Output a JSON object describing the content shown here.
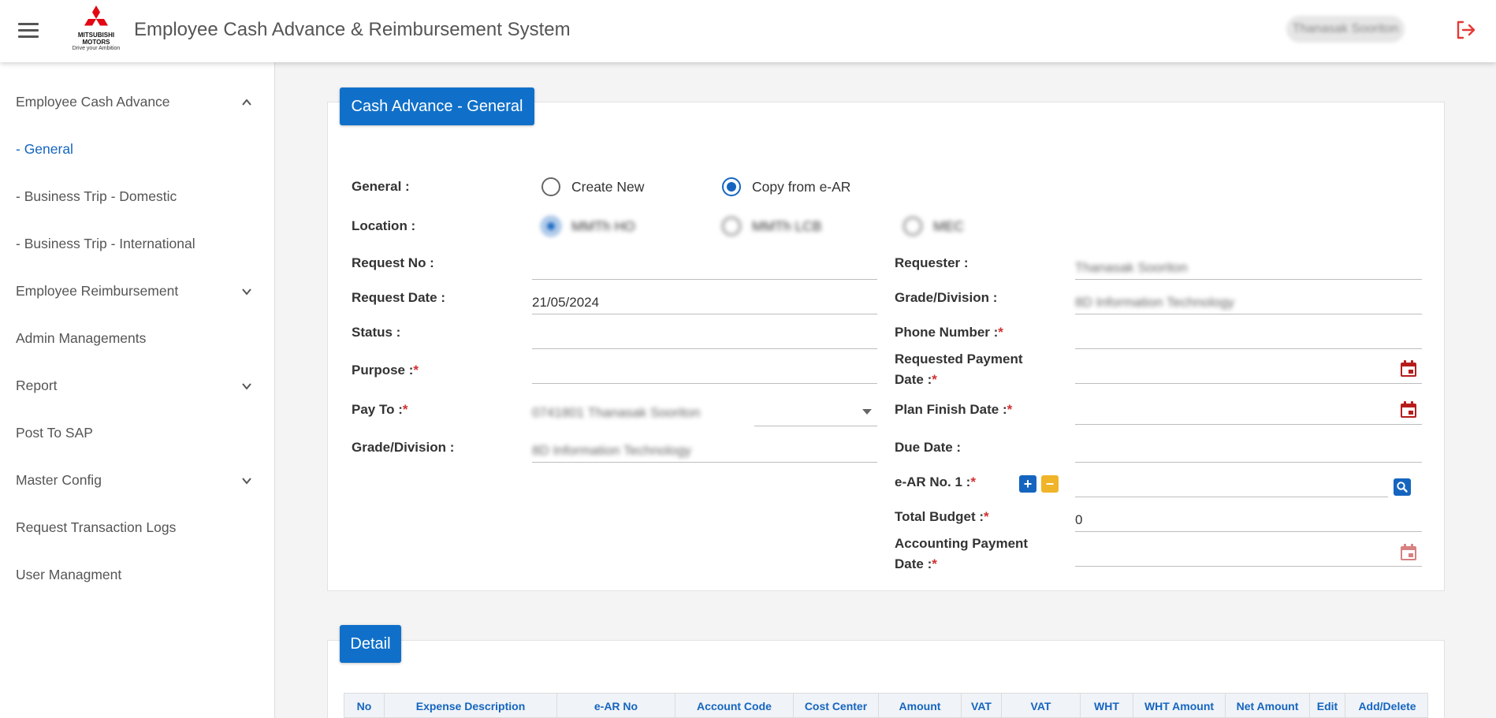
{
  "header": {
    "app_title": "Employee Cash Advance & Reimbursement System",
    "logo_line1": "MITSUBISHI",
    "logo_line2": "MOTORS",
    "logo_tagline": "Drive your Ambition",
    "user_name": "Thanasak Sooriton",
    "icons": {
      "menu": "hamburger-icon",
      "logout": "logout-icon"
    }
  },
  "sidebar": {
    "items": [
      {
        "label": "Employee Cash Advance",
        "expanded": true
      },
      {
        "label": "- General",
        "active": true
      },
      {
        "label": "- Business Trip - Domestic"
      },
      {
        "label": "- Business Trip - International"
      },
      {
        "label": "Employee Reimbursement",
        "expandable": true
      },
      {
        "label": "Admin Managements"
      },
      {
        "label": "Report",
        "expandable": true
      },
      {
        "label": "Post To SAP"
      },
      {
        "label": "Master Config",
        "expandable": true
      },
      {
        "label": "Request Transaction Logs"
      },
      {
        "label": "User Managment"
      }
    ]
  },
  "general_section": {
    "title": "Cash Advance - General",
    "general_label": "General :",
    "general_options": [
      {
        "label": "Create New",
        "checked": false
      },
      {
        "label": "Copy from e-AR",
        "checked": true
      }
    ],
    "location_label": "Location :",
    "location_options": [
      {
        "label": "MMTh HO",
        "checked": true
      },
      {
        "label": "MMTh LCB",
        "checked": false
      },
      {
        "label": "MEC",
        "checked": false
      }
    ],
    "left_fields": {
      "request_no": {
        "label": "Request No :",
        "value": ""
      },
      "request_date": {
        "label": "Request Date :",
        "value": "21/05/2024"
      },
      "status": {
        "label": "Status :",
        "value": ""
      },
      "purpose": {
        "label": "Purpose :",
        "value": ""
      },
      "pay_to": {
        "label": "Pay To :",
        "value": "0741801 Thanasak Sooriton"
      },
      "grade_division": {
        "label": "Grade/Division :",
        "value": "8D Information Technology"
      }
    },
    "right_fields": {
      "requester": {
        "label": "Requester :",
        "value": "Thanasak Sooriton"
      },
      "grade_division": {
        "label": "Grade/Division :",
        "value": "8D Information Technology"
      },
      "phone_number": {
        "label": "Phone Number :",
        "value": ""
      },
      "requested_payment_date": {
        "label_line1": "Requested Payment",
        "label_line2": "Date :",
        "value": ""
      },
      "plan_finish_date": {
        "label": "Plan Finish Date :",
        "value": ""
      },
      "due_date": {
        "label": "Due Date :",
        "value": ""
      },
      "ear_no": {
        "label": "e-AR No. 1 :",
        "value": ""
      },
      "total_budget": {
        "label": "Total Budget :",
        "value": "0"
      },
      "accounting_payment_date": {
        "label_line1": "Accounting Payment",
        "label_line2": "Date :",
        "value": ""
      }
    },
    "required_mark": "*",
    "colors": {
      "accent": "#1070c9",
      "required": "#d32f2f",
      "calendar": "#b71c1c",
      "minus_button": "#f0b429"
    }
  },
  "detail_section": {
    "title": "Detail",
    "columns": [
      "No",
      "Expense Description",
      "e-AR No",
      "Account Code",
      "Cost Center",
      "Amount",
      "VAT",
      "VAT",
      "WHT",
      "WHT Amount",
      "Net Amount",
      "Edit",
      "Add/Delete"
    ]
  }
}
